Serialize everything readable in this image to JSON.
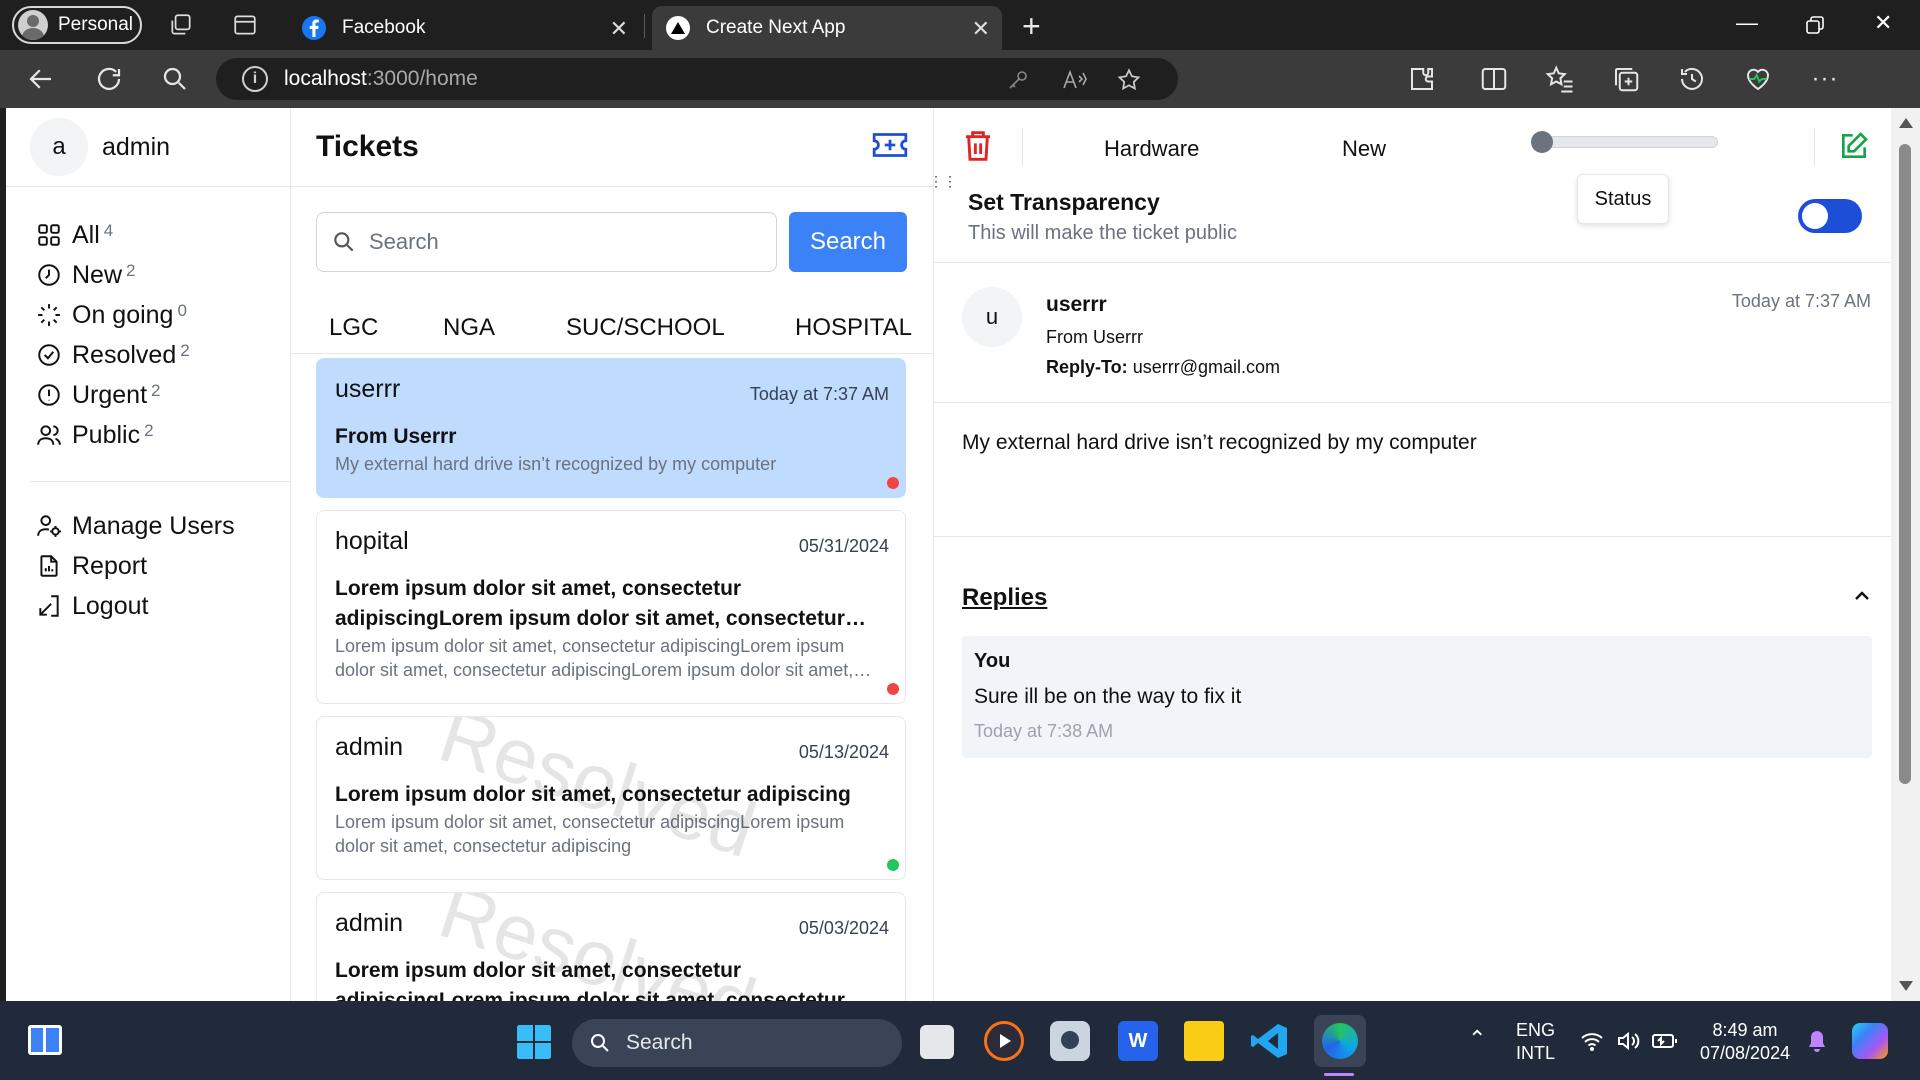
{
  "browser": {
    "profile_label": "Personal",
    "tabs": [
      {
        "title": "Facebook",
        "active": false
      },
      {
        "title": "Create Next App",
        "active": true
      }
    ],
    "url_host": "localhost",
    "url_path": ":3000/home"
  },
  "sidebar": {
    "avatar_letter": "a",
    "username": "admin",
    "filters": [
      {
        "label": "All",
        "count": "4",
        "icon": "grid-icon"
      },
      {
        "label": "New",
        "count": "2",
        "icon": "clock-icon"
      },
      {
        "label": "On going",
        "count": "0",
        "icon": "loader-icon"
      },
      {
        "label": "Resolved",
        "count": "2",
        "icon": "check-circle-icon"
      },
      {
        "label": "Urgent",
        "count": "2",
        "icon": "alert-circle-icon"
      },
      {
        "label": "Public",
        "count": "2",
        "icon": "users-icon"
      }
    ],
    "menu": [
      {
        "label": "Manage Users",
        "icon": "user-cog-icon"
      },
      {
        "label": "Report",
        "icon": "file-report-icon"
      },
      {
        "label": "Logout",
        "icon": "logout-icon"
      }
    ]
  },
  "list": {
    "title": "Tickets",
    "search_placeholder": "Search",
    "search_button": "Search",
    "categories": [
      "LGC",
      "NGA",
      "SUC/SCHOOL",
      "HOSPITAL"
    ],
    "tickets": [
      {
        "name": "userrr",
        "date": "Today at 7:37 AM",
        "subject": "From Userrr",
        "body": "My external hard drive isn’t recognized by my computer",
        "status_color": "#ef4444",
        "watermark": ""
      },
      {
        "name": "hopital",
        "date": "05/31/2024",
        "subject": "Lorem ipsum dolor sit amet, consectetur adipiscingLorem ipsum dolor sit amet, consectetur adipiscing",
        "body": "Lorem ipsum dolor sit amet, consectetur adipiscingLorem ipsum dolor sit amet, consectetur adipiscingLorem ipsum dolor sit amet, consectetur adipiscing",
        "status_color": "#ef4444",
        "watermark": ""
      },
      {
        "name": "admin",
        "date": "05/13/2024",
        "subject": "Lorem ipsum dolor sit amet, consectetur adipiscing",
        "body": "Lorem ipsum dolor sit amet, consectetur adipiscingLorem ipsum dolor sit amet, consectetur adipiscing",
        "status_color": "#22c55e",
        "watermark": "Resolved"
      },
      {
        "name": "admin",
        "date": "05/03/2024",
        "subject": "Lorem ipsum dolor sit amet, consectetur adipiscingLorem ipsum dolor sit amet, consectetur adipiscing",
        "body": "",
        "status_color": "#22c55e",
        "watermark": "Resolved"
      }
    ]
  },
  "detail": {
    "category": "Hardware",
    "status": "New",
    "priority_level": 0,
    "tooltip": "Status",
    "transparency_title": "Set Transparency",
    "transparency_desc": "This will make the ticket public",
    "transparency_on": true,
    "sender_letter": "u",
    "sender_name": "userrr",
    "sender_from": "From Userrr",
    "reply_to_label": "Reply-To:",
    "reply_to_value": "userrr@gmail.com",
    "time": "Today at 7:37 AM",
    "message": "My external hard drive isn’t recognized by my computer",
    "replies_title": "Replies",
    "replies": [
      {
        "who": "You",
        "text": "Sure ill be on the way to fix it",
        "time": "Today at 7:38 AM"
      }
    ]
  },
  "taskbar": {
    "search_label": "Search",
    "lang_1": "ENG",
    "lang_2": "INTL",
    "clock_time": "8:49 am",
    "clock_date": "07/08/2024"
  },
  "colors": {
    "accent": "#3b82f6",
    "selected_ticket": "#bfdbfe",
    "danger": "#dc2626",
    "success": "#16a34a"
  }
}
